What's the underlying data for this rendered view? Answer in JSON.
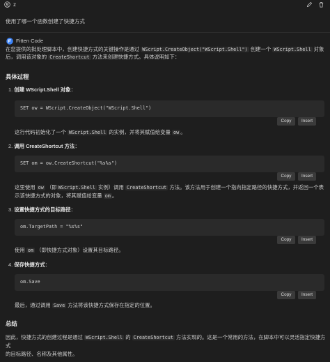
{
  "user": {
    "name": "z",
    "message": "使用了哪一个函数创建了快捷方式"
  },
  "assistant": {
    "name": "Fitten Code",
    "intro": {
      "p1": "在您提供的批处理脚本中，创建快捷方式的关键操作是通过",
      "c1": "WScript.CreateObject(\"WScript.Shell\")",
      "p2": "创建一个",
      "c2": "WScript.Shell",
      "p3": "对象",
      "p4": "后，调用该对象的",
      "c3": "CreateShortcut",
      "p5": "方法来创建快捷方式。具体说明如下："
    },
    "section_title": "具体过程",
    "steps": [
      {
        "num": "1.",
        "title_a": "创建 ",
        "title_b": "WScript.Shell",
        "title_c": " 对象",
        "title_colon": "：",
        "code": "SET ow = WScript.CreateObject(\"WScript.Shell\")",
        "desc": {
          "a": "这行代码初始化了一个",
          "c1": "WScript.Shell",
          "b": "的实例，并将其赋值给变量",
          "c2": "ow",
          "c": "。"
        }
      },
      {
        "num": "2.",
        "title_a": "调用 ",
        "title_b": "CreateShortcut",
        "title_c": " 方法",
        "title_colon": "：",
        "code": "SET om = ow.CreateShortcut(\"%s%s\")",
        "desc": {
          "a": "这里使用",
          "c1": "ow",
          "b": "（即",
          "c2": "WScript.Shell",
          "c": "实例）调用",
          "c3": "CreateShortcut",
          "d": "方法。该方法用于创建一个指向指定路径的快捷方式，并返回一个表",
          "e": "示该快捷方式的对象，将其赋值给变量",
          "c4": "om",
          "f": "。"
        }
      },
      {
        "num": "3.",
        "title_a": "设置快捷方式的目标路径",
        "title_colon": "：",
        "code": "om.TargetPath = \"%s%s\"",
        "desc": {
          "c1": "om",
          "a": "（即快捷方式对象）设置其目标路径。",
          "pre": "使用"
        }
      },
      {
        "num": "4.",
        "title_a": "保存快捷方式",
        "title_colon": "：",
        "code": "om.Save",
        "desc": {
          "a": "最后，通过调用",
          "c1": "Save",
          "b": "方法将该快捷方式保存在指定的位置。"
        }
      }
    ],
    "summary_title": "总结",
    "summary": {
      "a": "因此，快捷方式的创建过程是通过",
      "c1": "WScript.Shell",
      "b": "的",
      "c2": "CreateShortcut",
      "c": "方法实现的。这是一个常用的方法，在脚本中可以灵活指定快捷方式",
      "d": "的目标路径、名称及其他属性。"
    },
    "copy_label": "Copy",
    "insert_label": "Insert"
  },
  "colors": {
    "background": "#1e1e1e",
    "code_background": "#2a2a2a",
    "button_background": "#3a3a3a",
    "bot_icon": "#3b82f6"
  },
  "icons": [
    "account-icon",
    "edit-icon",
    "trash-icon",
    "fitten-code-icon"
  ]
}
